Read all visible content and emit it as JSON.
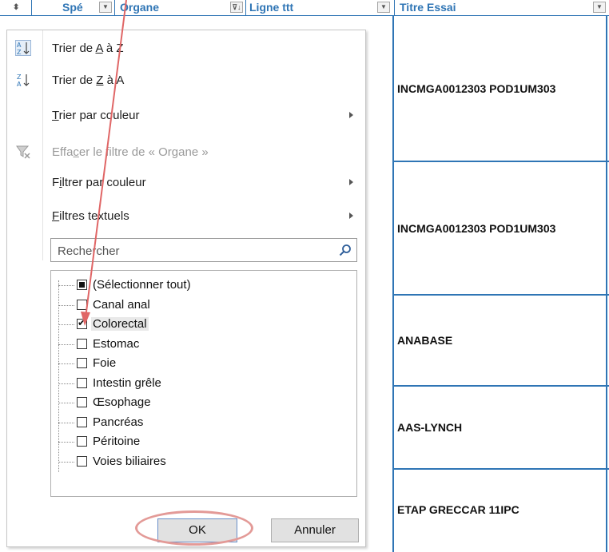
{
  "header": {
    "columns": [
      {
        "label": ""
      },
      {
        "label": "Spé"
      },
      {
        "label": "Organe"
      },
      {
        "label": "Ligne ttt"
      },
      {
        "label": "Titre Essai"
      }
    ]
  },
  "rows": [
    {
      "titre": "INCMGA0012303 POD1UM303"
    },
    {
      "titre": "INCMGA0012303 POD1UM303"
    },
    {
      "titre": "ANABASE"
    },
    {
      "titre": "AAS-LYNCH"
    },
    {
      "titre": "ETAP GRECCAR 11IPC"
    }
  ],
  "menu": {
    "sort_az": {
      "prefix": "Trier de ",
      "key": "A",
      "suffix": " à Z"
    },
    "sort_za": {
      "prefix": "Trier de ",
      "key": "Z",
      "suffix": " à A"
    },
    "sort_color": {
      "key": "T",
      "rest": "rier par couleur"
    },
    "clear_filter": {
      "prefix": "Effa",
      "key": "c",
      "suffix": "er le filtre de « Organe »"
    },
    "filter_color": {
      "prefix": "F",
      "key": "i",
      "suffix": "ltrer par couleur"
    },
    "text_filters": {
      "key": "F",
      "suffix": "iltres textuels"
    },
    "search_placeholder": "Rechercher",
    "items": [
      {
        "label": "(Sélectionner tout)",
        "state": "indeterminate"
      },
      {
        "label": "Canal anal",
        "state": "unchecked"
      },
      {
        "label": "Colorectal",
        "state": "checked"
      },
      {
        "label": "Estomac",
        "state": "unchecked"
      },
      {
        "label": "Foie",
        "state": "unchecked"
      },
      {
        "label": "Intestin grêle",
        "state": "unchecked"
      },
      {
        "label": "Œsophage",
        "state": "unchecked"
      },
      {
        "label": "Pancréas",
        "state": "unchecked"
      },
      {
        "label": "Péritoine",
        "state": "unchecked"
      },
      {
        "label": "Voies biliaires",
        "state": "unchecked"
      }
    ],
    "ok_label": "OK",
    "cancel_label": "Annuler"
  },
  "colors": {
    "header_text": "#2f75b5",
    "grid_line": "#2f75b5",
    "annotation": "#e06666"
  }
}
